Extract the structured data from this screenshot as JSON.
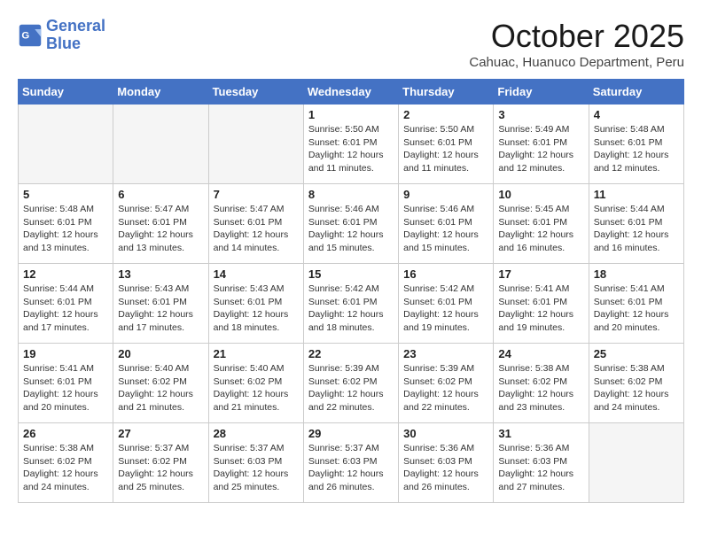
{
  "logo": {
    "text_general": "General",
    "text_blue": "Blue"
  },
  "title": "October 2025",
  "location": "Cahuac, Huanuco Department, Peru",
  "days_of_week": [
    "Sunday",
    "Monday",
    "Tuesday",
    "Wednesday",
    "Thursday",
    "Friday",
    "Saturday"
  ],
  "weeks": [
    [
      {
        "day": "",
        "empty": true
      },
      {
        "day": "",
        "empty": true
      },
      {
        "day": "",
        "empty": true
      },
      {
        "day": "1",
        "sunrise": "5:50 AM",
        "sunset": "6:01 PM",
        "daylight": "12 hours and 11 minutes."
      },
      {
        "day": "2",
        "sunrise": "5:50 AM",
        "sunset": "6:01 PM",
        "daylight": "12 hours and 11 minutes."
      },
      {
        "day": "3",
        "sunrise": "5:49 AM",
        "sunset": "6:01 PM",
        "daylight": "12 hours and 12 minutes."
      },
      {
        "day": "4",
        "sunrise": "5:48 AM",
        "sunset": "6:01 PM",
        "daylight": "12 hours and 12 minutes."
      }
    ],
    [
      {
        "day": "5",
        "sunrise": "5:48 AM",
        "sunset": "6:01 PM",
        "daylight": "12 hours and 13 minutes."
      },
      {
        "day": "6",
        "sunrise": "5:47 AM",
        "sunset": "6:01 PM",
        "daylight": "12 hours and 13 minutes."
      },
      {
        "day": "7",
        "sunrise": "5:47 AM",
        "sunset": "6:01 PM",
        "daylight": "12 hours and 14 minutes."
      },
      {
        "day": "8",
        "sunrise": "5:46 AM",
        "sunset": "6:01 PM",
        "daylight": "12 hours and 15 minutes."
      },
      {
        "day": "9",
        "sunrise": "5:46 AM",
        "sunset": "6:01 PM",
        "daylight": "12 hours and 15 minutes."
      },
      {
        "day": "10",
        "sunrise": "5:45 AM",
        "sunset": "6:01 PM",
        "daylight": "12 hours and 16 minutes."
      },
      {
        "day": "11",
        "sunrise": "5:44 AM",
        "sunset": "6:01 PM",
        "daylight": "12 hours and 16 minutes."
      }
    ],
    [
      {
        "day": "12",
        "sunrise": "5:44 AM",
        "sunset": "6:01 PM",
        "daylight": "12 hours and 17 minutes."
      },
      {
        "day": "13",
        "sunrise": "5:43 AM",
        "sunset": "6:01 PM",
        "daylight": "12 hours and 17 minutes."
      },
      {
        "day": "14",
        "sunrise": "5:43 AM",
        "sunset": "6:01 PM",
        "daylight": "12 hours and 18 minutes."
      },
      {
        "day": "15",
        "sunrise": "5:42 AM",
        "sunset": "6:01 PM",
        "daylight": "12 hours and 18 minutes."
      },
      {
        "day": "16",
        "sunrise": "5:42 AM",
        "sunset": "6:01 PM",
        "daylight": "12 hours and 19 minutes."
      },
      {
        "day": "17",
        "sunrise": "5:41 AM",
        "sunset": "6:01 PM",
        "daylight": "12 hours and 19 minutes."
      },
      {
        "day": "18",
        "sunrise": "5:41 AM",
        "sunset": "6:01 PM",
        "daylight": "12 hours and 20 minutes."
      }
    ],
    [
      {
        "day": "19",
        "sunrise": "5:41 AM",
        "sunset": "6:01 PM",
        "daylight": "12 hours and 20 minutes."
      },
      {
        "day": "20",
        "sunrise": "5:40 AM",
        "sunset": "6:02 PM",
        "daylight": "12 hours and 21 minutes."
      },
      {
        "day": "21",
        "sunrise": "5:40 AM",
        "sunset": "6:02 PM",
        "daylight": "12 hours and 21 minutes."
      },
      {
        "day": "22",
        "sunrise": "5:39 AM",
        "sunset": "6:02 PM",
        "daylight": "12 hours and 22 minutes."
      },
      {
        "day": "23",
        "sunrise": "5:39 AM",
        "sunset": "6:02 PM",
        "daylight": "12 hours and 22 minutes."
      },
      {
        "day": "24",
        "sunrise": "5:38 AM",
        "sunset": "6:02 PM",
        "daylight": "12 hours and 23 minutes."
      },
      {
        "day": "25",
        "sunrise": "5:38 AM",
        "sunset": "6:02 PM",
        "daylight": "12 hours and 24 minutes."
      }
    ],
    [
      {
        "day": "26",
        "sunrise": "5:38 AM",
        "sunset": "6:02 PM",
        "daylight": "12 hours and 24 minutes."
      },
      {
        "day": "27",
        "sunrise": "5:37 AM",
        "sunset": "6:02 PM",
        "daylight": "12 hours and 25 minutes."
      },
      {
        "day": "28",
        "sunrise": "5:37 AM",
        "sunset": "6:03 PM",
        "daylight": "12 hours and 25 minutes."
      },
      {
        "day": "29",
        "sunrise": "5:37 AM",
        "sunset": "6:03 PM",
        "daylight": "12 hours and 26 minutes."
      },
      {
        "day": "30",
        "sunrise": "5:36 AM",
        "sunset": "6:03 PM",
        "daylight": "12 hours and 26 minutes."
      },
      {
        "day": "31",
        "sunrise": "5:36 AM",
        "sunset": "6:03 PM",
        "daylight": "12 hours and 27 minutes."
      },
      {
        "day": "",
        "empty": true
      }
    ]
  ]
}
